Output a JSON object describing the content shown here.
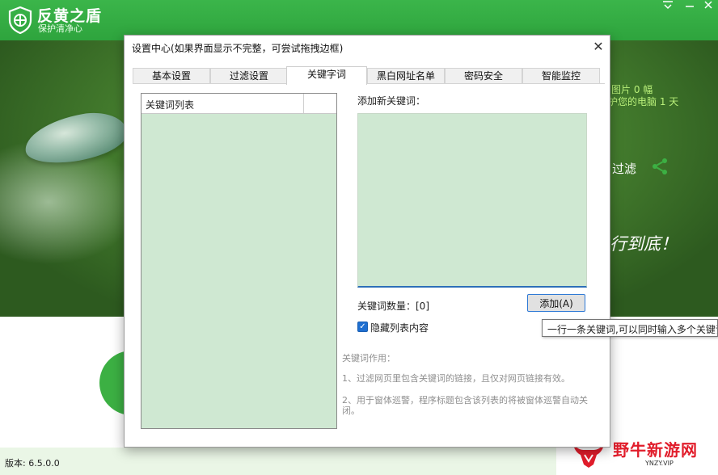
{
  "app": {
    "title": "反黄之盾",
    "subtitle": "保护清净心",
    "version": "版本: 6.5.0.0",
    "banner_line1": "图片 0 幅",
    "banner_line2": "护您的电脑 1 天",
    "filter_label": "过滤",
    "slogan": "行到底！",
    "colors": {
      "header_green": "#2ea43d",
      "accent_green": "#3cb043"
    }
  },
  "watermark": {
    "text": "野牛新游网",
    "domain": "YNZY.VIP"
  },
  "dialog": {
    "title": "设置中心(如果界面显示不完整，可尝试拖拽边框)",
    "close_glyph": "✕",
    "tabs": [
      {
        "label": "基本设置",
        "active": false
      },
      {
        "label": "过滤设置",
        "active": false
      },
      {
        "label": "关键字词",
        "active": true
      },
      {
        "label": "黑白网址名单",
        "active": false
      },
      {
        "label": "密码安全",
        "active": false
      },
      {
        "label": "智能监控",
        "active": false
      }
    ],
    "keyword_panel": {
      "list_header": "关键词列表",
      "add_label": "添加新关键词：",
      "input_value": "",
      "count_label": "关键词数量：[0]",
      "add_button": "添加(A)",
      "hide_checkbox_label": "隐藏列表内容",
      "hide_checked": true,
      "help_title": "关键词作用：",
      "help_1": "1、过滤网页里包含关键词的链接，且仅对网页链接有效。",
      "help_2": "2、用于窗体巡警，程序标题包含该列表的将被窗体巡警自动关闭。"
    },
    "tooltip": "一行一条关键词,可以同时输入多个关键词"
  }
}
